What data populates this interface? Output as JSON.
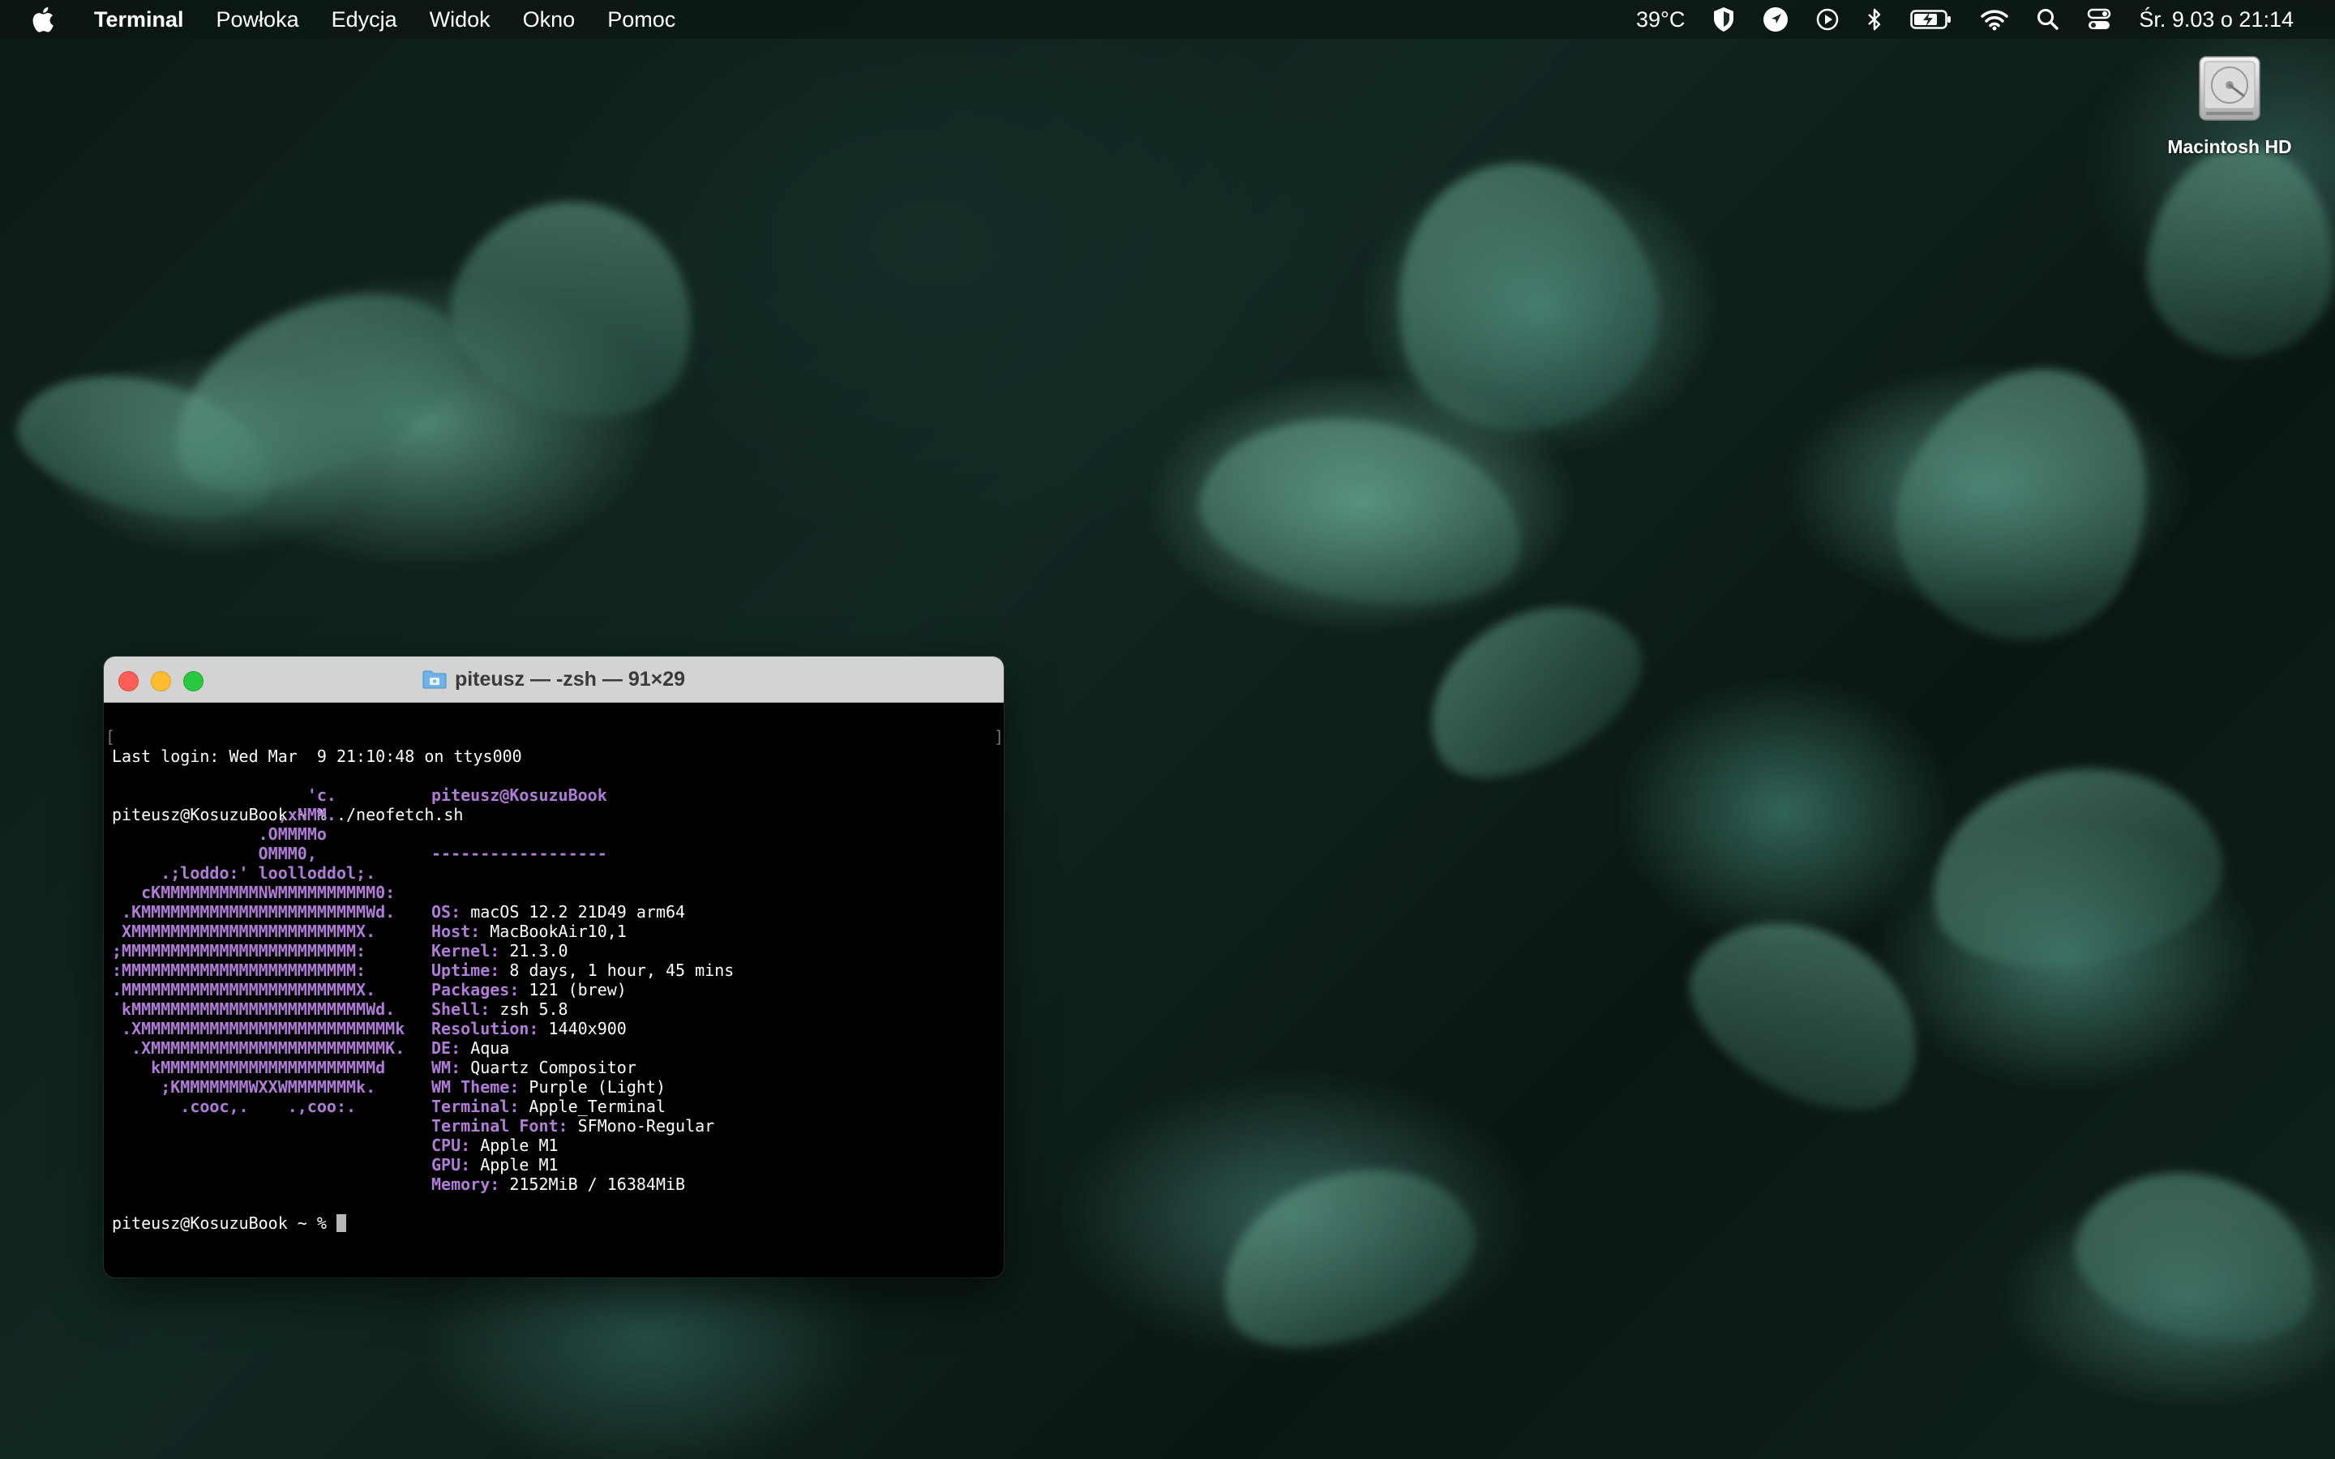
{
  "menubar": {
    "app": "Terminal",
    "menus": [
      "Powłoka",
      "Edycja",
      "Widok",
      "Okno",
      "Pomoc"
    ],
    "status": {
      "temperature": "39°C",
      "datetime": "Śr. 9.03 o  21:14"
    },
    "icons": [
      "apple-icon",
      "shield-icon",
      "location-icon",
      "play-icon",
      "bluetooth-icon",
      "battery-icon",
      "wifi-icon",
      "spotlight-icon",
      "control-center-icon"
    ]
  },
  "desktop": {
    "drive_label": "Macintosh HD"
  },
  "terminal": {
    "title": "piteusz — -zsh — 91×29",
    "last_login": "Last login: Wed Mar  9 21:10:48 on ttys000",
    "command_line": "piteusz@KosuzuBook ~ % ./neofetch.sh",
    "final_prompt": "piteusz@KosuzuBook ~ % ",
    "logo_lines": [
      "                    'c.",
      "                 ,xNMM.",
      "               .OMMMMo",
      "               OMMM0,",
      "     .;loddo:' loolloddol;.",
      "   cKMMMMMMMMMMNWMMMMMMMMMM0:",
      " .KMMMMMMMMMMMMMMMMMMMMMMMWd.",
      " XMMMMMMMMMMMMMMMMMMMMMMMX.",
      ";MMMMMMMMMMMMMMMMMMMMMMMM:",
      ":MMMMMMMMMMMMMMMMMMMMMMMM:",
      ".MMMMMMMMMMMMMMMMMMMMMMMMX.",
      " kMMMMMMMMMMMMMMMMMMMMMMMMWd.",
      " .XMMMMMMMMMMMMMMMMMMMMMMMMMMk",
      "  .XMMMMMMMMMMMMMMMMMMMMMMMMK.",
      "    kMMMMMMMMMMMMMMMMMMMMMMd",
      "     ;KMMMMMMMWXXWMMMMMMMk.",
      "       .cooc,.    .,coo:."
    ],
    "user_host": "piteusz@KosuzuBook",
    "separator": "------------------",
    "info": [
      {
        "key": "OS",
        "value": "macOS 12.2 21D49 arm64"
      },
      {
        "key": "Host",
        "value": "MacBookAir10,1"
      },
      {
        "key": "Kernel",
        "value": "21.3.0"
      },
      {
        "key": "Uptime",
        "value": "8 days, 1 hour, 45 mins"
      },
      {
        "key": "Packages",
        "value": "121 (brew)"
      },
      {
        "key": "Shell",
        "value": "zsh 5.8"
      },
      {
        "key": "Resolution",
        "value": "1440x900"
      },
      {
        "key": "DE",
        "value": "Aqua"
      },
      {
        "key": "WM",
        "value": "Quartz Compositor"
      },
      {
        "key": "WM Theme",
        "value": "Purple (Light)"
      },
      {
        "key": "Terminal",
        "value": "Apple_Terminal"
      },
      {
        "key": "Terminal Font",
        "value": "SFMono-Regular"
      },
      {
        "key": "CPU",
        "value": "Apple M1"
      },
      {
        "key": "GPU",
        "value": "Apple M1"
      },
      {
        "key": "Memory",
        "value": "2152MiB / 16384MiB"
      }
    ],
    "palette": {
      "normal": [
        "#000000",
        "#c0393b",
        "#4fa352",
        "#b5ad43",
        "#3d5fb5",
        "#8f5fb2",
        "#3f9f97",
        "#c6c6c6"
      ],
      "bright": [
        "#606060",
        "#e25555",
        "#6fcf6f",
        "#dfd56b",
        "#5c80df",
        "#b07cd8",
        "#6cc7c0",
        "#e6e6e6"
      ]
    }
  }
}
